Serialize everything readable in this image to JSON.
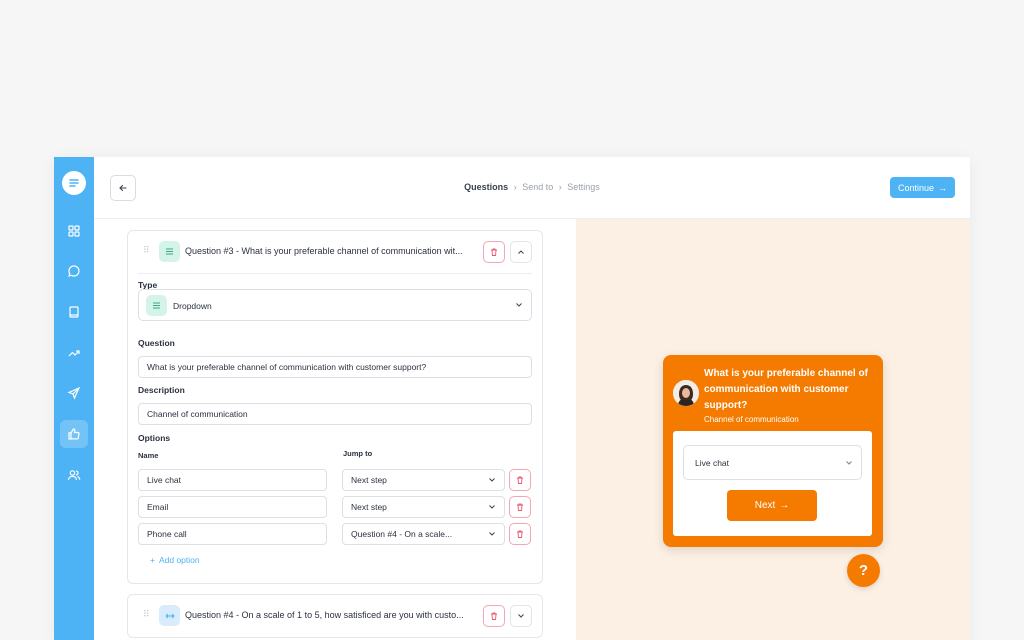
{
  "topbar": {
    "steps": [
      "Questions",
      "Send to",
      "Settings"
    ],
    "step_separator": "›",
    "continue_label": "Continue",
    "continue_arrow": "→"
  },
  "sidebar": {
    "items": [
      {
        "icon": "dashboard-icon"
      },
      {
        "icon": "chat-icon"
      },
      {
        "icon": "book-icon"
      },
      {
        "icon": "trending-icon"
      },
      {
        "icon": "send-icon"
      },
      {
        "icon": "thumbs-up-icon",
        "active": true
      },
      {
        "icon": "users-icon"
      }
    ]
  },
  "question3": {
    "title": "Question #3 - What is your preferable channel of communication wit...",
    "type_label": "Type",
    "type_value": "Dropdown",
    "question_label": "Question",
    "question_value": "What is your preferable channel of communication with customer support?",
    "description_label": "Description",
    "description_value": "Channel of communication",
    "options_label": "Options",
    "name_col": "Name",
    "jump_col": "Jump to",
    "options": [
      {
        "name": "Live chat",
        "jump": "Next step"
      },
      {
        "name": "Email",
        "jump": "Next step"
      },
      {
        "name": "Phone call",
        "jump": "Question #4 - On a scale..."
      }
    ],
    "add_option": "Add option"
  },
  "question4": {
    "title": "Question #4 - On a scale of 1 to 5, how satisficed are you with custo..."
  },
  "preview": {
    "question": "What is your preferable channel of communication with customer support?",
    "description": "Channel of communication",
    "selected": "Live chat",
    "next_label": "Next",
    "next_arrow": "→",
    "help": "?"
  },
  "colors": {
    "sidebar": "#4db3f5",
    "accent": "#4db3f5",
    "widget": "#f47b00",
    "preview_bg": "#fcefe4",
    "danger": "#e8566f"
  }
}
